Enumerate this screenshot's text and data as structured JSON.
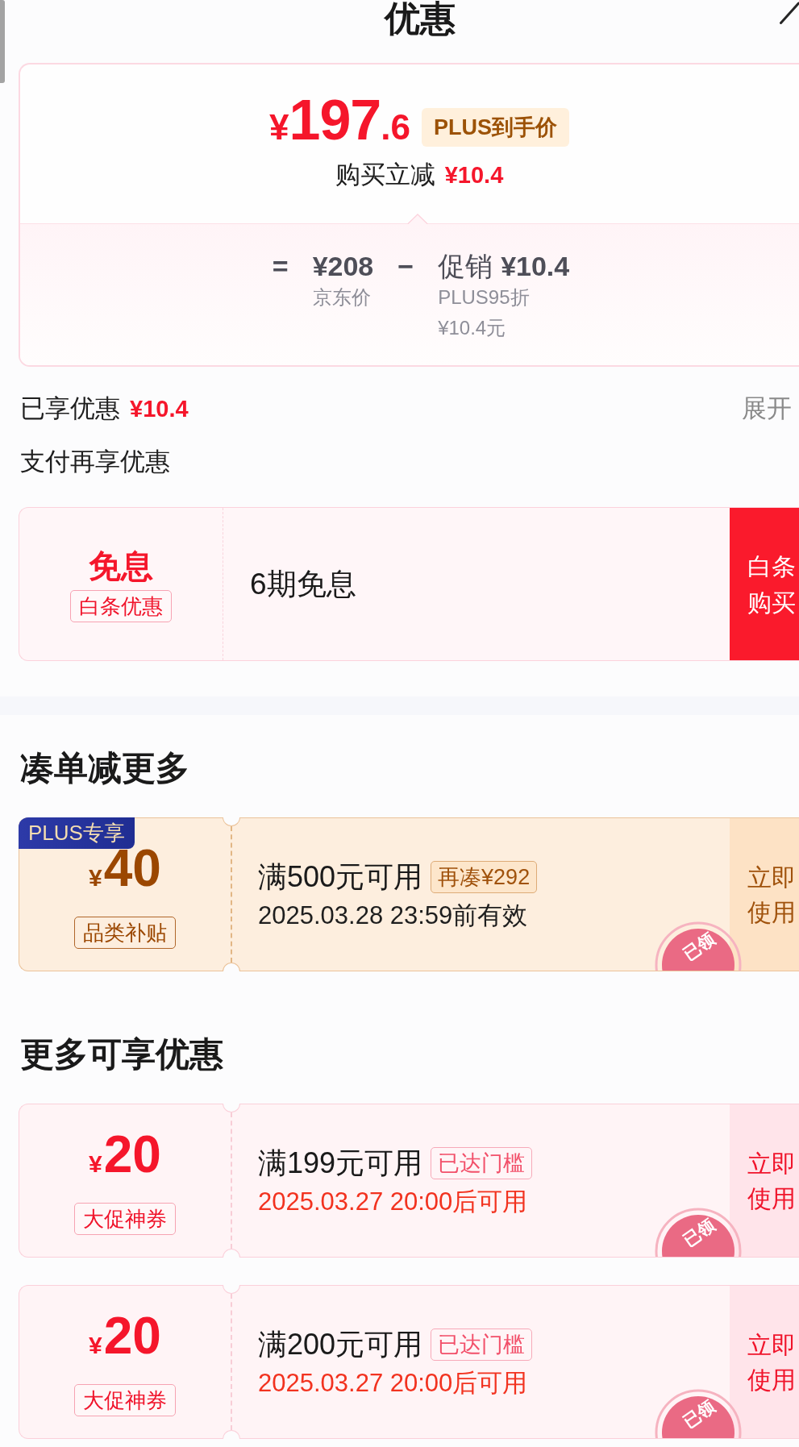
{
  "header": {
    "title": "优惠"
  },
  "price_card": {
    "currency": "¥",
    "price_integer": "197",
    "price_decimal": ".6",
    "badge": "PLUS到手价",
    "reduction_label": "购买立减",
    "reduction_amount": "¥10.4",
    "breakdown": {
      "equals": "=",
      "base_price": "¥208",
      "base_label": "京东价",
      "minus": "−",
      "promo_label": "促销",
      "promo_amount": "¥10.4",
      "promo_details": [
        "PLUS95折",
        "¥10.4元"
      ]
    }
  },
  "savings": {
    "label": "已享优惠",
    "amount": "¥10.4",
    "toggle": "展开"
  },
  "payment_section": {
    "title": "支付再享优惠",
    "offers": [
      {
        "kind": "installment",
        "headline": "免息",
        "tag": "白条优惠",
        "description": "6期免息",
        "action": "白条购买"
      }
    ]
  },
  "coupon_sections": [
    {
      "title": "凑单减更多",
      "coupons": [
        {
          "kind": "plus",
          "corner_badge": "PLUS专享",
          "currency": "¥",
          "amount": "40",
          "tag": "品类补贴",
          "condition": "满500元可用",
          "condition_tag": "再凑¥292",
          "validity": "2025.03.28 23:59前有效",
          "action": "立即使用",
          "stamp": "已领"
        }
      ]
    },
    {
      "title": "更多可享优惠",
      "coupons": [
        {
          "kind": "promo",
          "currency": "¥",
          "amount": "20",
          "tag": "大促神券",
          "condition": "满199元可用",
          "condition_tag": "已达门槛",
          "validity": "2025.03.27 20:00后可用",
          "action": "立即使用",
          "stamp": "已领"
        },
        {
          "kind": "promo",
          "currency": "¥",
          "amount": "20",
          "tag": "大促神券",
          "condition": "满200元可用",
          "condition_tag": "已达门槛",
          "validity": "2025.03.27 20:00后可用",
          "action": "立即使用",
          "stamp": "已领"
        }
      ]
    }
  ]
}
